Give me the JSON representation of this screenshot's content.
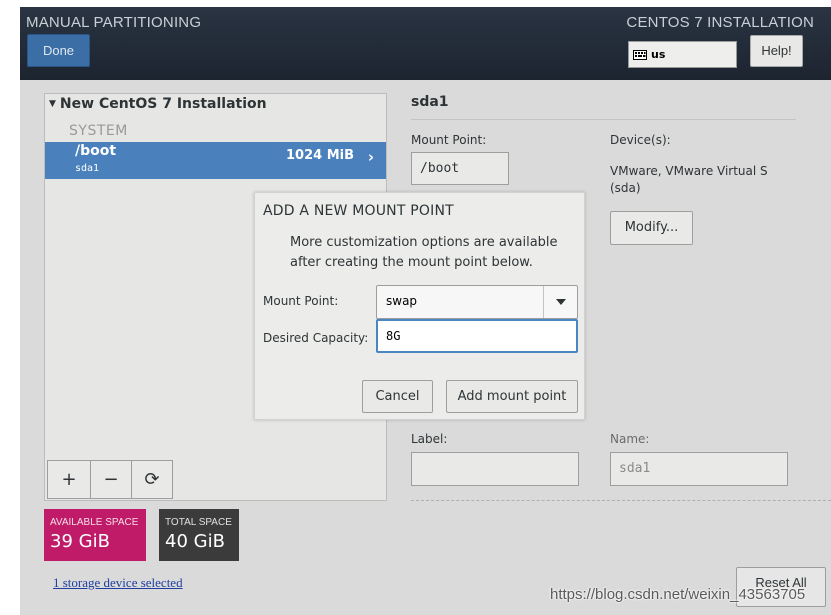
{
  "header": {
    "title": "MANUAL PARTITIONING",
    "product": "CENTOS 7 INSTALLATION",
    "done_label": "Done",
    "keyboard_layout": "us",
    "help_label": "Help!"
  },
  "left_panel": {
    "tree_title": "New CentOS 7 Installation",
    "section_label": "SYSTEM",
    "selected_mount": {
      "name": "/boot",
      "device": "sda1",
      "size": "1024 MiB"
    },
    "toolbar": {
      "add_label": "+",
      "remove_label": "−",
      "refresh_label": "⟳"
    }
  },
  "space": {
    "available_label": "AVAILABLE SPACE",
    "available_value": "39 GiB",
    "total_label": "TOTAL SPACE",
    "total_value": "40 GiB",
    "storage_link": "1 storage device selected"
  },
  "right_panel": {
    "title": "sda1",
    "mount_point_label": "Mount Point:",
    "mount_point_value": "/boot",
    "devices_label": "Device(s):",
    "device_text": "VMware, VMware Virtual S (sda)",
    "modify_label": "Modify...",
    "label_label": "Label:",
    "label_value": "",
    "name_label": "Name:",
    "name_value": "sda1",
    "reset_label": "Reset All"
  },
  "dialog": {
    "title": "ADD A NEW MOUNT POINT",
    "description": "More customization options are available after creating the mount point below.",
    "mount_point_label": "Mount Point:",
    "mount_point_value": "swap",
    "capacity_label": "Desired Capacity:",
    "capacity_value": "8G",
    "cancel_label": "Cancel",
    "add_label": "Add mount point"
  },
  "watermark": "https://blog.csdn.net/weixin_43563705"
}
